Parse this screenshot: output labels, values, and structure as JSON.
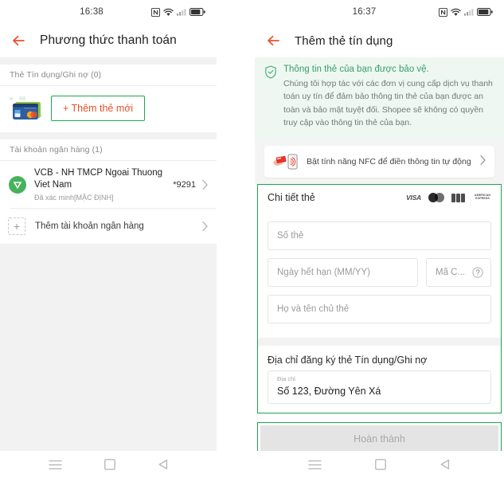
{
  "left_screen": {
    "status_bar": {
      "clock": "16:38",
      "icons": [
        "nfc-icon",
        "wifi-icon",
        "signal-icon",
        "battery-icon"
      ]
    },
    "app_bar": {
      "back_icon": "back-arrow-icon",
      "title": "Phương thức thanh toán"
    },
    "credit_section": {
      "label": "Thẻ Tín dụng/Ghi nợ (0)",
      "card_illustration": "credit-cards-illustration",
      "add_card_label": "+ Thêm thẻ mới"
    },
    "bank_section": {
      "label": "Tài khoản ngân hàng (1)",
      "account": {
        "logo": "vcb-bank-logo",
        "name": "VCB - NH TMCP Ngoai Thuong Viet Nam",
        "status": "Đã xác minh[MẶC ĐỊNH]",
        "masked_number": "*9291",
        "chevron": "chevron-right-icon"
      },
      "add_bank_label": "Thêm tài khoản ngân hàng",
      "add_bank_plus": "+"
    },
    "nav_bar": {
      "recents": "menu-icon",
      "home": "square-icon",
      "back": "triangle-back-icon"
    }
  },
  "right_screen": {
    "status_bar": {
      "clock": "16:37",
      "icons": [
        "nfc-icon",
        "wifi-icon",
        "signal-icon",
        "battery-icon"
      ]
    },
    "app_bar": {
      "back_icon": "back-arrow-icon",
      "title": "Thêm thẻ tín dụng"
    },
    "notice": {
      "icon": "shield-check-icon",
      "title": "Thông tin thẻ của bạn được bảo vệ.",
      "body": "Chúng tôi hợp tác với các đơn vị cung cấp dịch vụ thanh toán uy tín để đảm bảo thông tin thẻ của bạn được an toàn và bảo mật tuyệt đối. Shopee sẽ không có quyền truy cập vào thông tin thẻ của bạn."
    },
    "nfc_banner": {
      "icon": "nfc-tap-card-illustration",
      "label": "Bật tính năng NFC để điền thông tin tự động",
      "chevron": "chevron-right-icon"
    },
    "card_details": {
      "title": "Chi tiết thẻ",
      "brands": [
        "VISA",
        "Mastercard",
        "JCB",
        "AMERICAN EXPRESS"
      ],
      "amex_line1": "AMERICAN",
      "amex_line2": "EXPRESS",
      "fields": {
        "card_number_placeholder": "Số thẻ",
        "card_number_value": "",
        "expiry_placeholder": "Ngày hết hạn (MM/YY)",
        "expiry_value": "",
        "cvv_placeholder": "Mã C...",
        "cvv_value": "",
        "cvv_help_icon": "question-mark-icon",
        "holder_placeholder": "Họ và tên chủ thẻ",
        "holder_value": ""
      }
    },
    "billing_address": {
      "title": "Địa chỉ đăng ký thẻ Tín dụng/Ghi nợ",
      "field_label": "Địa chỉ",
      "field_value": "Số 123, Đường Yên Xá"
    },
    "submit": {
      "label": "Hoàn thành",
      "disabled": true
    },
    "nav_bar": {
      "recents": "menu-icon",
      "home": "square-icon",
      "back": "triangle-back-icon"
    }
  },
  "colors": {
    "highlight_green": "#1aa64b",
    "accent_orange": "#e8502a",
    "notice_green": "#3aa06a",
    "notice_bg": "#eef7f1",
    "band_gray": "#f2f2f2"
  }
}
